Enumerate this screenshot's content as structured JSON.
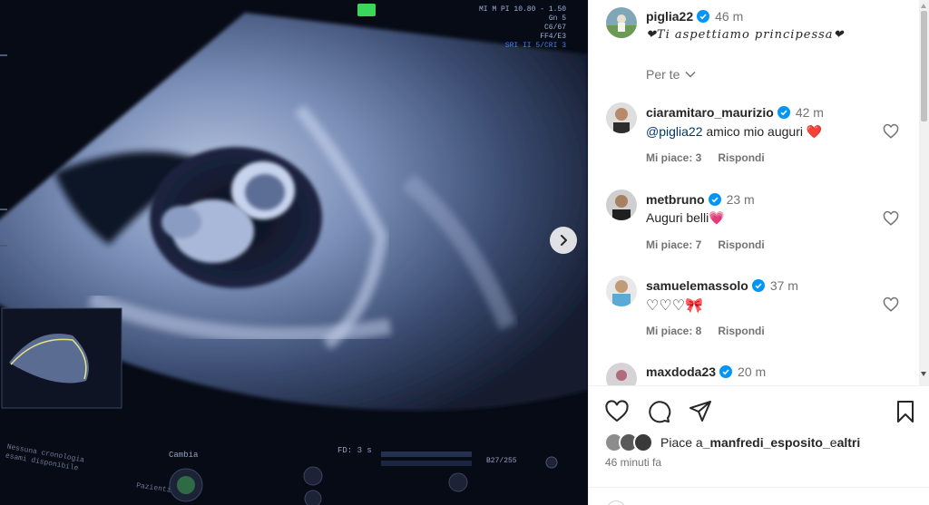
{
  "post": {
    "author": "piglia22",
    "time": "46 m",
    "caption": "❤Ti aspettiamo principessa❤",
    "sort_label": "Per te"
  },
  "comments": [
    {
      "user": "ciaramitaro_maurizio",
      "time": "42 m",
      "mention": "@piglia22",
      "text": " amico mio auguri ",
      "emoji": "❤️",
      "likes": "Mi piace: 3",
      "reply": "Rispondi"
    },
    {
      "user": "metbruno",
      "time": "23 m",
      "mention": "",
      "text": "Auguri belli",
      "emoji": "💗",
      "likes": "Mi piace: 7",
      "reply": "Rispondi"
    },
    {
      "user": "samuelemassolo",
      "time": "37 m",
      "mention": "",
      "text": "♡♡♡",
      "emoji": "🎀",
      "likes": "Mi piace: 8",
      "reply": "Rispondi"
    },
    {
      "user": "maxdoda23",
      "time": "20 m",
      "mention": "",
      "text": "",
      "emoji": "",
      "likes": "",
      "reply": ""
    }
  ],
  "liked_by": {
    "prefix": "Piace a ",
    "user": "_manfredi_esposito_",
    "suffix": " e ",
    "others": "altri"
  },
  "post_age": "46 minuti fa",
  "ultrasound_overlay": {
    "top_right": [
      "MI M PI 10.80 - 1.50",
      "Gn 5",
      "C6/67",
      "FF4/E3",
      "SRI II 5/CRI 3"
    ],
    "bottom_left": [
      "Nessuna cronologia",
      "esami disponibile"
    ],
    "bottom_left2": "Pazienti",
    "cambia": "Cambia",
    "frame_label": "FD: 3 s",
    "frame_count": "B27/255"
  },
  "icons": [
    "verified-badge-icon",
    "heart-icon",
    "comment-icon",
    "share-icon",
    "bookmark-icon",
    "chevron-right-icon",
    "chevron-down-icon"
  ],
  "colors": {
    "verified": "#0095f6",
    "heart_red": "#ed1c24",
    "link": "#00376b",
    "muted": "#737373"
  }
}
